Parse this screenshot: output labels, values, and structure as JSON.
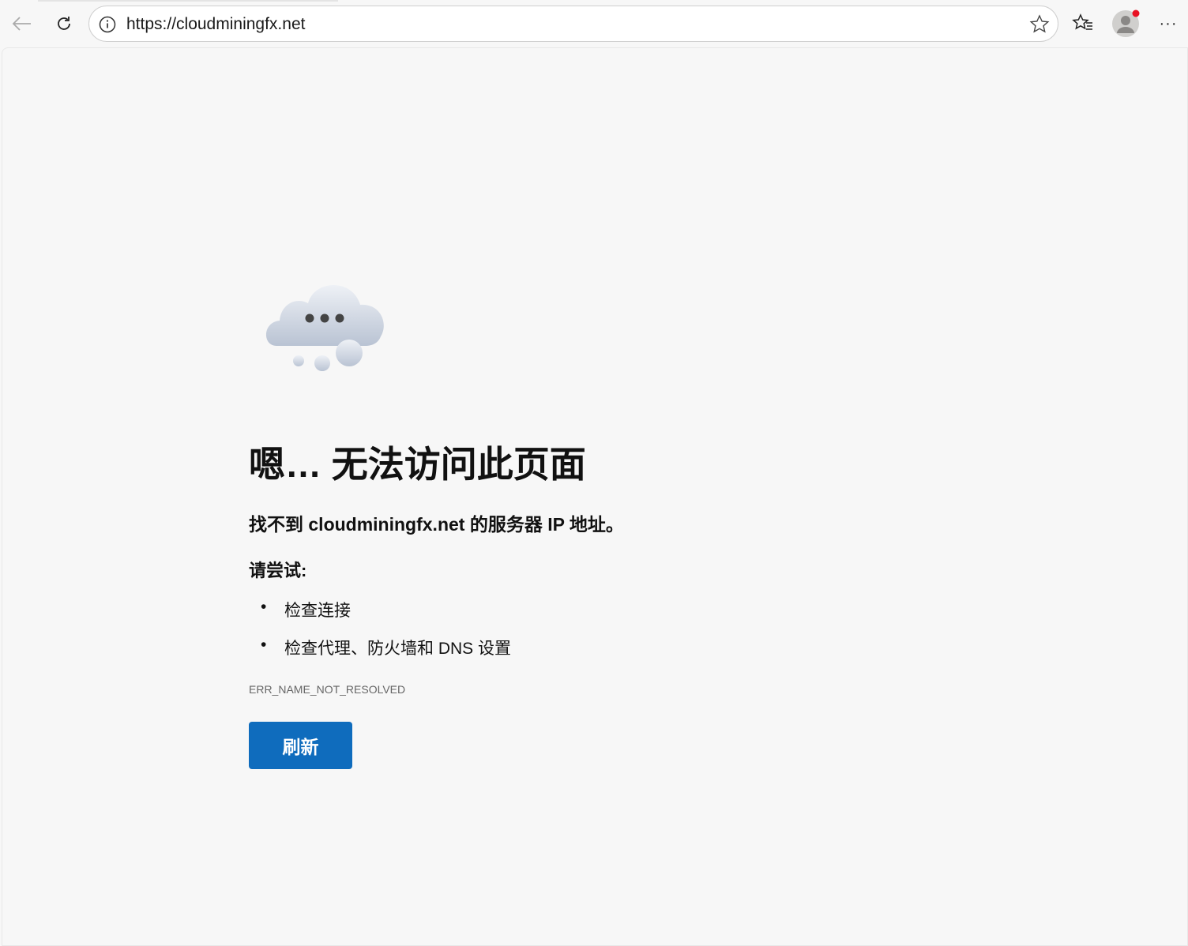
{
  "browser": {
    "url": "https://cloudminingfx.net"
  },
  "error": {
    "title": "嗯… 无法访问此页面",
    "subtitle": "找不到 cloudminingfx.net 的服务器 IP 地址。",
    "try_label": "请尝试:",
    "suggestions": [
      "检查连接",
      "检查代理、防火墙和 DNS 设置"
    ],
    "code": "ERR_NAME_NOT_RESOLVED",
    "reload_label": "刷新"
  },
  "colors": {
    "accent": "#0f6cbd",
    "notification": "#e81123"
  }
}
